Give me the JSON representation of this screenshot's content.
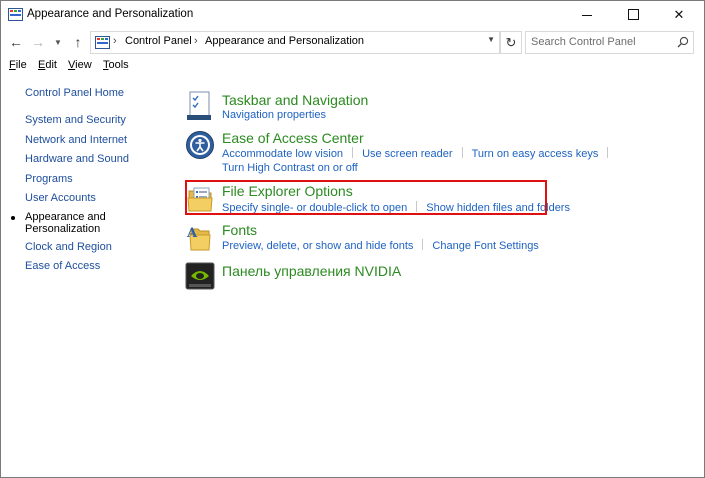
{
  "window": {
    "title": "Appearance and Personalization",
    "controls": {
      "minimize": "minimize",
      "maximize": "maximize",
      "close": "✕"
    }
  },
  "address": {
    "crumbs": [
      "Control Panel",
      "Appearance and Personalization"
    ],
    "search_placeholder": "Search Control Panel"
  },
  "menu": [
    "File",
    "Edit",
    "View",
    "Tools"
  ],
  "sidebar": {
    "items": [
      {
        "label": "Control Panel Home"
      },
      {
        "label": "System and Security"
      },
      {
        "label": "Network and Internet"
      },
      {
        "label": "Hardware and Sound"
      },
      {
        "label": "Programs"
      },
      {
        "label": "User Accounts"
      },
      {
        "label": "Appearance and",
        "label2": "Personalization",
        "current": true
      },
      {
        "label": "Clock and Region"
      },
      {
        "label": "Ease of Access"
      }
    ]
  },
  "categories": [
    {
      "title": "Taskbar and Navigation",
      "icon": "taskbar-icon",
      "links": [
        "Navigation properties"
      ]
    },
    {
      "title": "Ease of Access Center",
      "icon": "ease-of-access-icon",
      "links": [
        "Accommodate low vision",
        "Use screen reader",
        "Turn on easy access keys"
      ],
      "links2": [
        "Turn High Contrast on or off"
      ]
    },
    {
      "title": "File Explorer Options",
      "icon": "folder-options-icon",
      "links": [
        "Specify single- or double-click to open",
        "Show hidden files and folders"
      ],
      "highlighted": true
    },
    {
      "title": "Fonts",
      "icon": "fonts-folder-icon",
      "links": [
        "Preview, delete, or show and hide fonts",
        "Change Font Settings"
      ]
    },
    {
      "title": "Панель управления NVIDIA",
      "icon": "nvidia-icon",
      "links": []
    }
  ],
  "colors": {
    "category_title": "#2b8a20",
    "link": "#1e62c1",
    "nav_link": "#1e4e9c",
    "highlight": "#e01010"
  }
}
